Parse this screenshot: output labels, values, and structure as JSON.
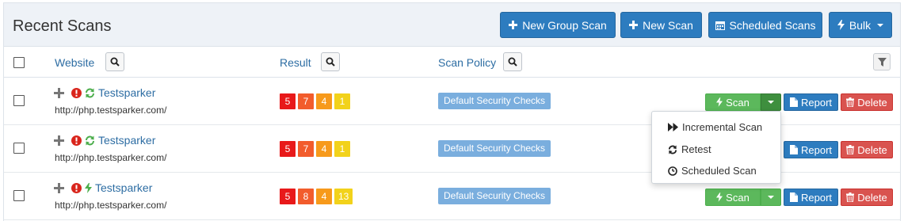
{
  "header": {
    "title": "Recent Scans",
    "buttons": {
      "new_group_scan": "New Group Scan",
      "new_scan": "New Scan",
      "scheduled_scans": "Scheduled Scans",
      "bulk": "Bulk"
    }
  },
  "columns": {
    "website": "Website",
    "result": "Result",
    "scan_policy": "Scan Policy"
  },
  "rows": [
    {
      "name": "Testsparker",
      "url": "http://php.testsparker.com/",
      "status_icon": "refresh-icon",
      "severity": [
        "5",
        "7",
        "4",
        "1"
      ],
      "policy": "Default Security Checks",
      "scan_label": "Scan",
      "report_label": "Report",
      "delete_label": "Delete"
    },
    {
      "name": "Testsparker",
      "url": "http://php.testsparker.com/",
      "status_icon": "refresh-icon",
      "severity": [
        "5",
        "7",
        "4",
        "1"
      ],
      "policy": "Default Security Checks",
      "scan_label": "Scan",
      "report_label": "Report",
      "delete_label": "Delete"
    },
    {
      "name": "Testsparker",
      "url": "http://php.testsparker.com/",
      "status_icon": "bolt-icon",
      "severity": [
        "5",
        "8",
        "4",
        "13"
      ],
      "policy": "Default Security Checks",
      "scan_label": "Scan",
      "report_label": "Report",
      "delete_label": "Delete"
    }
  ],
  "dropdown": {
    "items": [
      "Incremental Scan",
      "Retest",
      "Scheduled Scan"
    ]
  },
  "colors": {
    "primary": "#2d7cbf",
    "success": "#5cb85c",
    "danger": "#d9534f",
    "critical": "#e8191a",
    "high": "#f25c2c",
    "medium": "#f79a1b",
    "low": "#f2d21b",
    "policy": "#7aaede"
  }
}
